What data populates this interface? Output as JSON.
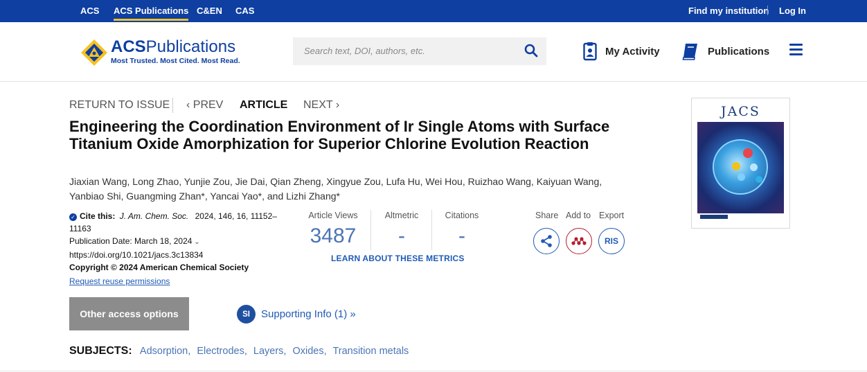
{
  "topbar": {
    "links": [
      "ACS",
      "ACS Publications",
      "C&EN",
      "CAS"
    ],
    "find_institution": "Find my institution",
    "log_in": "Log In"
  },
  "header": {
    "logo_main_a": "ACS",
    "logo_main_b": "Publications",
    "logo_tagline": "Most Trusted. Most Cited. Most Read.",
    "search_placeholder": "Search text, DOI, authors, etc.",
    "my_activity": "My Activity",
    "publications": "Publications"
  },
  "article_nav": {
    "return": "RETURN TO ISSUE",
    "prev": "PREV",
    "article": "ARTICLE",
    "next": "NEXT"
  },
  "article": {
    "title": "Engineering the Coordination Environment of Ir Single Atoms with Surface Titanium Oxide Amorphization for Superior Chlorine Evolution Reaction",
    "authors": "Jiaxian Wang, Long Zhao, Yunjie Zou, Jie Dai, Qian Zheng, Xingyue Zou, Lufa Hu, Wei Hou, Ruizhao Wang, Kaiyuan Wang, Yanbiao Shi, Guangming Zhan*, Yancai Yao*, and Lizhi Zhang*",
    "cite_label": "Cite this:",
    "journal": "J. Am. Chem. Soc.",
    "citation": "2024, 146, 16, 11152–11163",
    "pub_date": "Publication Date: March 18, 2024",
    "doi": "https://doi.org/10.1021/jacs.3c13834",
    "copyright": "Copyright © 2024 American Chemical Society",
    "reuse": "Request reuse permissions"
  },
  "metrics": {
    "views_label": "Article Views",
    "views_value": "3487",
    "altmetric_label": "Altmetric",
    "altmetric_value": "-",
    "citations_label": "Citations",
    "citations_value": "-",
    "learn_more": "LEARN ABOUT THESE METRICS"
  },
  "actions": {
    "share": "Share",
    "add_to": "Add to",
    "export": "Export",
    "ris": "RIS"
  },
  "cover": {
    "journal_short": "JACS"
  },
  "access": {
    "other_options": "Other access options",
    "si_badge": "SI",
    "supporting_info": "Supporting Info (1) »"
  },
  "subjects": {
    "label": "SUBJECTS:",
    "items": [
      "Adsorption",
      "Electrodes",
      "Layers",
      "Oxides",
      "Transition metals"
    ]
  },
  "colors": {
    "brand_blue": "#0e3fa1",
    "accent_yellow": "#f7c221",
    "link_blue": "#1f5ab5",
    "metric_blue": "#4c74b5",
    "mendeley_red": "#b41f2d",
    "button_gray": "#8c8c8c"
  }
}
